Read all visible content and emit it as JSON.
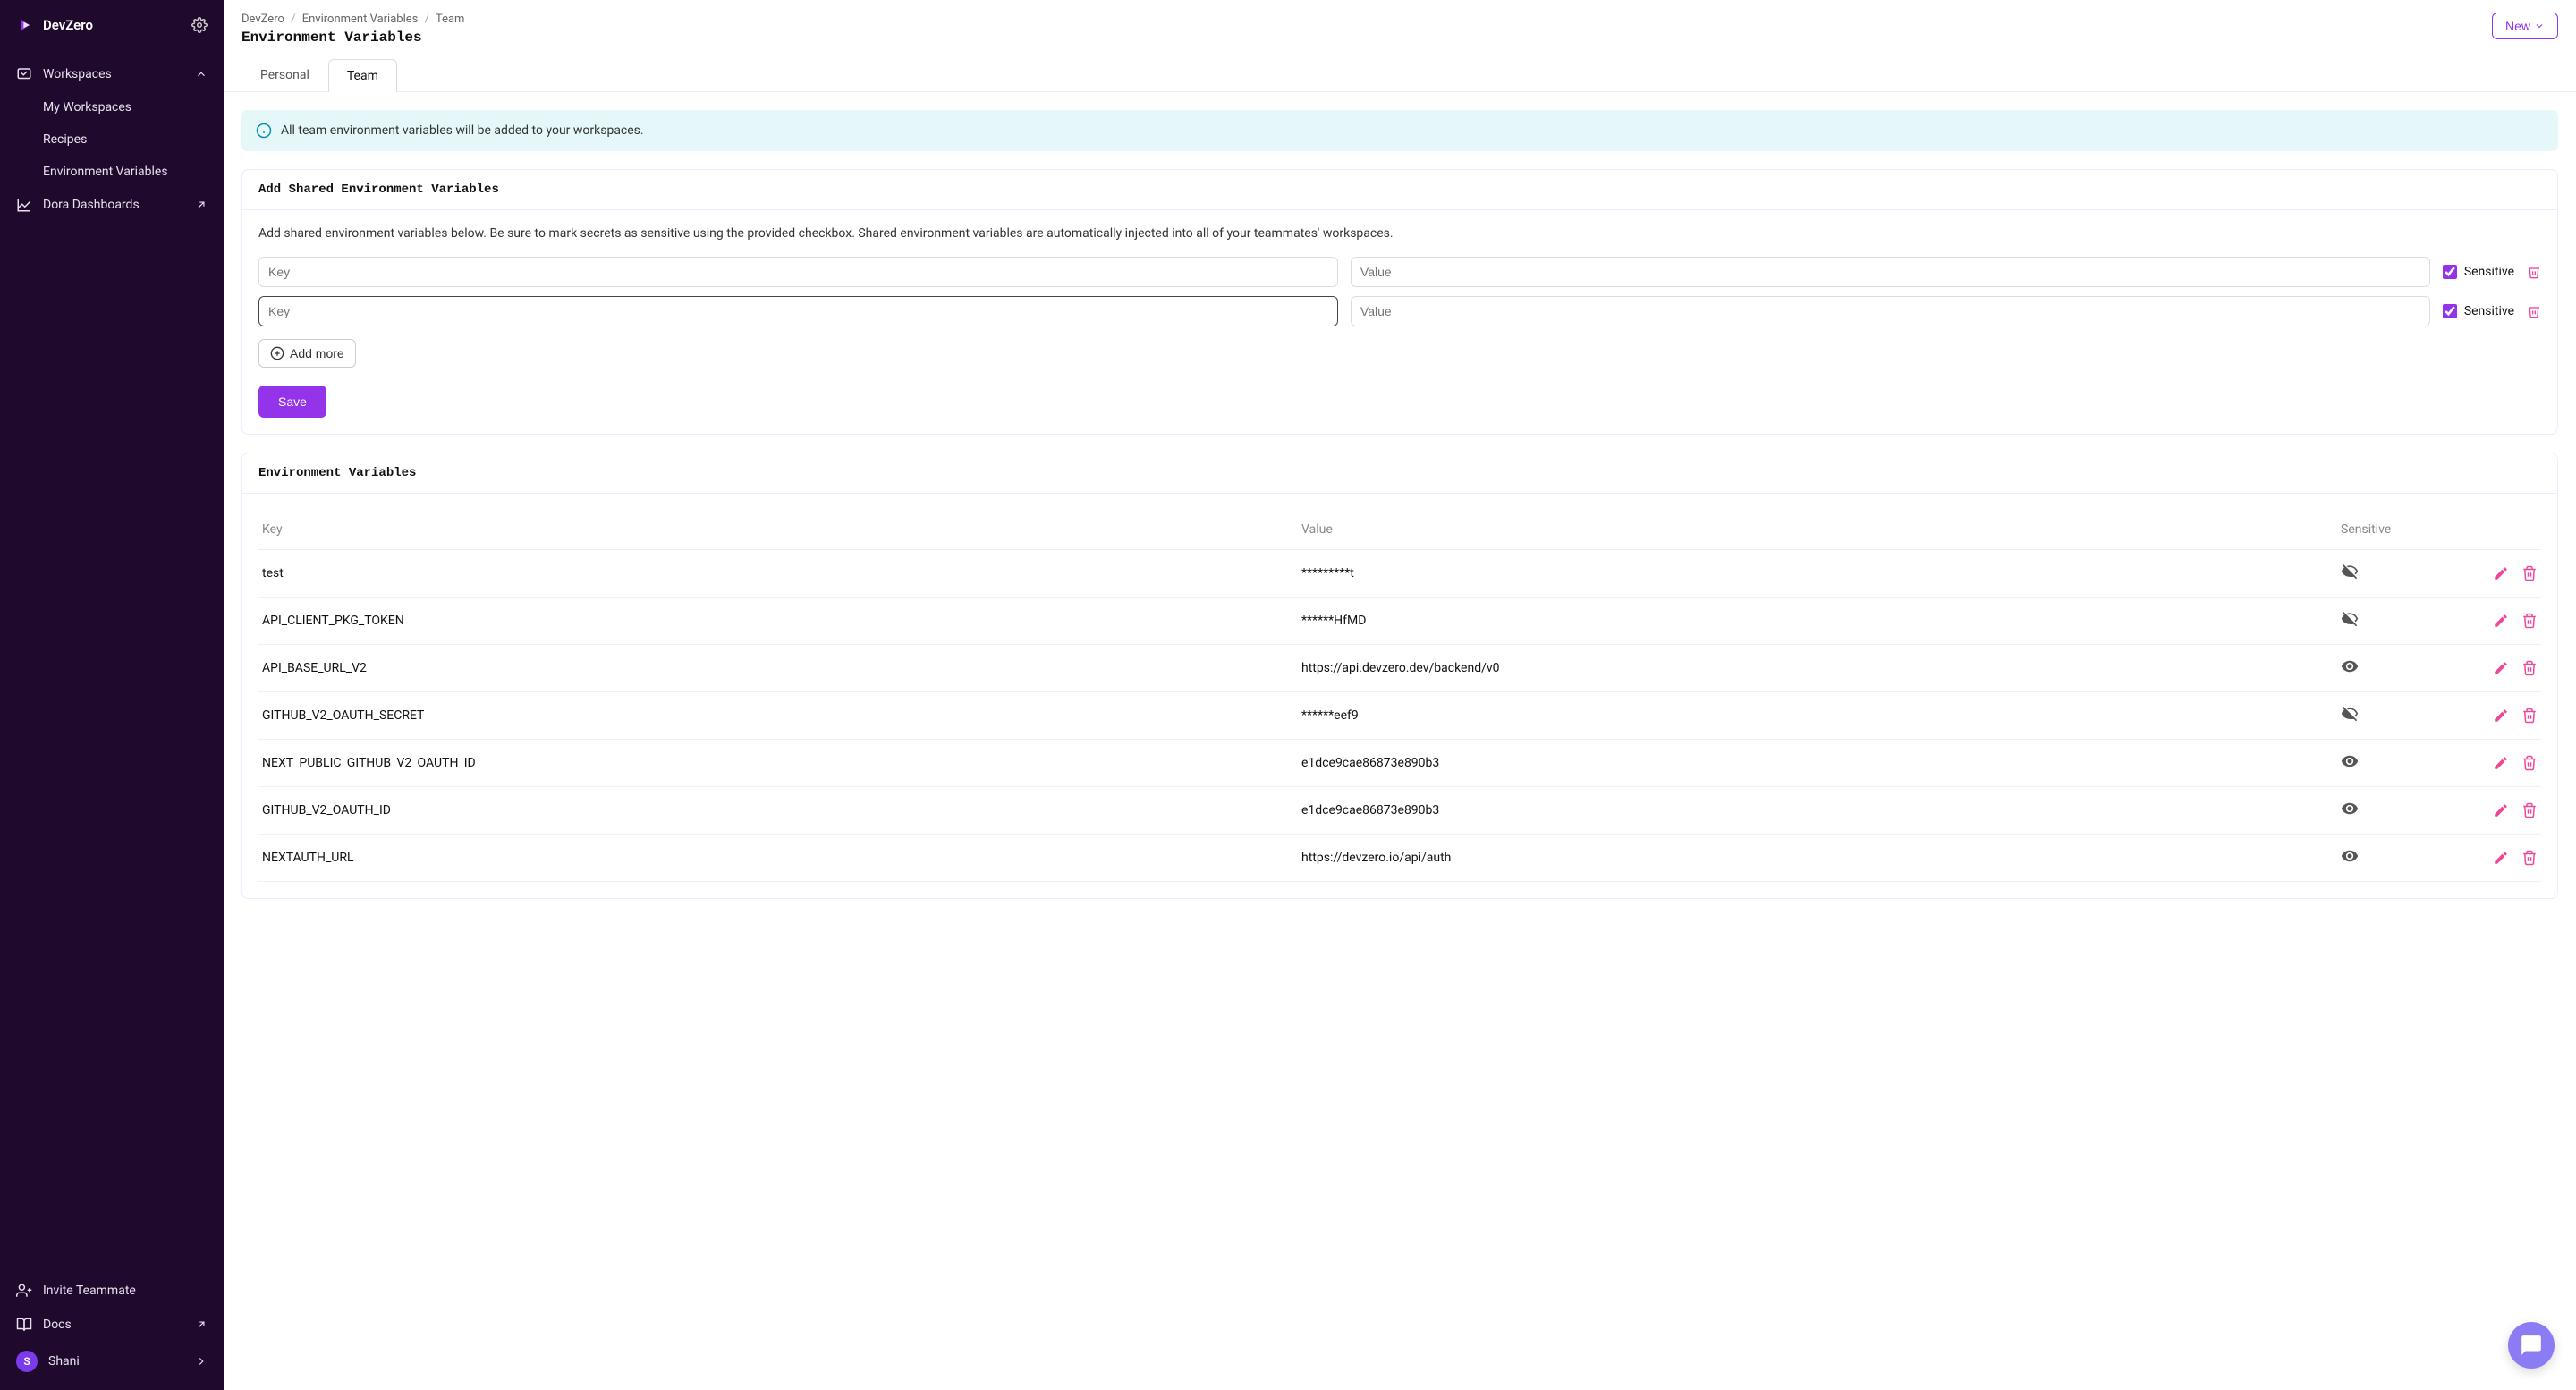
{
  "brand": "DevZero",
  "sidebar": {
    "sections": {
      "workspaces": {
        "label": "Workspaces"
      },
      "myWorkspaces": {
        "label": "My Workspaces"
      },
      "recipes": {
        "label": "Recipes"
      },
      "envVars": {
        "label": "Environment Variables"
      },
      "dora": {
        "label": "Dora Dashboards"
      }
    },
    "footer": {
      "invite": "Invite Teammate",
      "docs": "Docs",
      "userInitial": "S",
      "userName": "Shani"
    }
  },
  "breadcrumb": {
    "a": "DevZero",
    "b": "Environment Variables",
    "c": "Team"
  },
  "pageTitle": "Environment Variables",
  "newBtn": "New",
  "tabs": {
    "personal": "Personal",
    "team": "Team"
  },
  "banner": "All team environment variables will be added to your workspaces.",
  "addCard": {
    "title": "Add Shared Environment Variables",
    "desc": "Add shared environment variables below. Be sure to mark secrets as sensitive using the provided checkbox. Shared environment variables are automatically injected into all of your teammates' workspaces.",
    "keyPlaceholder": "Key",
    "valuePlaceholder": "Value",
    "sensitiveLabel": "Sensitive",
    "addMore": "Add more",
    "save": "Save"
  },
  "listCard": {
    "title": "Environment Variables",
    "cols": {
      "key": "Key",
      "value": "Value",
      "sensitive": "Sensitive"
    },
    "rows": [
      {
        "key": "test",
        "value": "*********t",
        "sensitive": true
      },
      {
        "key": "API_CLIENT_PKG_TOKEN",
        "value": "******HfMD",
        "sensitive": true
      },
      {
        "key": "API_BASE_URL_V2",
        "value": "https://api.devzero.dev/backend/v0",
        "sensitive": false
      },
      {
        "key": "GITHUB_V2_OAUTH_SECRET",
        "value": "******eef9",
        "sensitive": true
      },
      {
        "key": "NEXT_PUBLIC_GITHUB_V2_OAUTH_ID",
        "value": "e1dce9cae86873e890b3",
        "sensitive": false
      },
      {
        "key": "GITHUB_V2_OAUTH_ID",
        "value": "e1dce9cae86873e890b3",
        "sensitive": false
      },
      {
        "key": "NEXTAUTH_URL",
        "value": "https://devzero.io/api/auth",
        "sensitive": false
      }
    ]
  }
}
